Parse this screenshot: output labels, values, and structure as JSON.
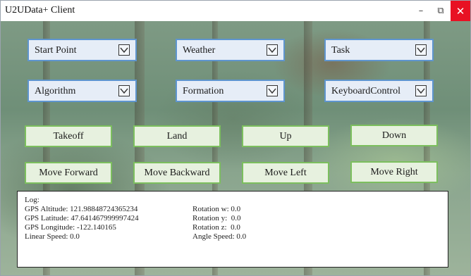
{
  "window": {
    "title": "U2UData+ Client"
  },
  "controls": {
    "minimize": "–",
    "restore": "⧉",
    "close": "✕"
  },
  "dropdowns": [
    {
      "label": "Start Point"
    },
    {
      "label": "Weather"
    },
    {
      "label": "Task"
    },
    {
      "label": "Algorithm"
    },
    {
      "label": "Formation"
    },
    {
      "label": "KeyboardControl"
    }
  ],
  "buttons": {
    "takeoff": "Takeoff",
    "land": "Land",
    "up": "Up",
    "down": "Down",
    "move_forward": "Move Forward",
    "move_backward": "Move Backward",
    "move_left": "Move Left",
    "move_right": "Move Right"
  },
  "log": {
    "header": "Log:",
    "gps_altitude": "GPS Altitude: 121.98848724365234",
    "gps_latitude": "GPS Latitude: 47.641467999997424",
    "gps_longitude": "GPS Longitude: -122.140165",
    "linear_speed": "Linear Speed: 0.0",
    "rotation_w": "Rotation w: 0.0",
    "rotation_y": "Rotation y:  0.0",
    "rotation_z": "Rotation z:  0.0",
    "angle_speed": "Angle Speed: 0.0"
  },
  "icons": {
    "chevron": "chevron-down-icon",
    "minimize": "minimize-icon",
    "restore": "restore-icon",
    "close": "close-icon"
  },
  "colors": {
    "dropdown_border": "#5e95cf",
    "dropdown_bg": "#e6edf7",
    "button_border": "#7cbf5e",
    "button_bg": "#e7f1df",
    "close_bg": "#e81123"
  }
}
